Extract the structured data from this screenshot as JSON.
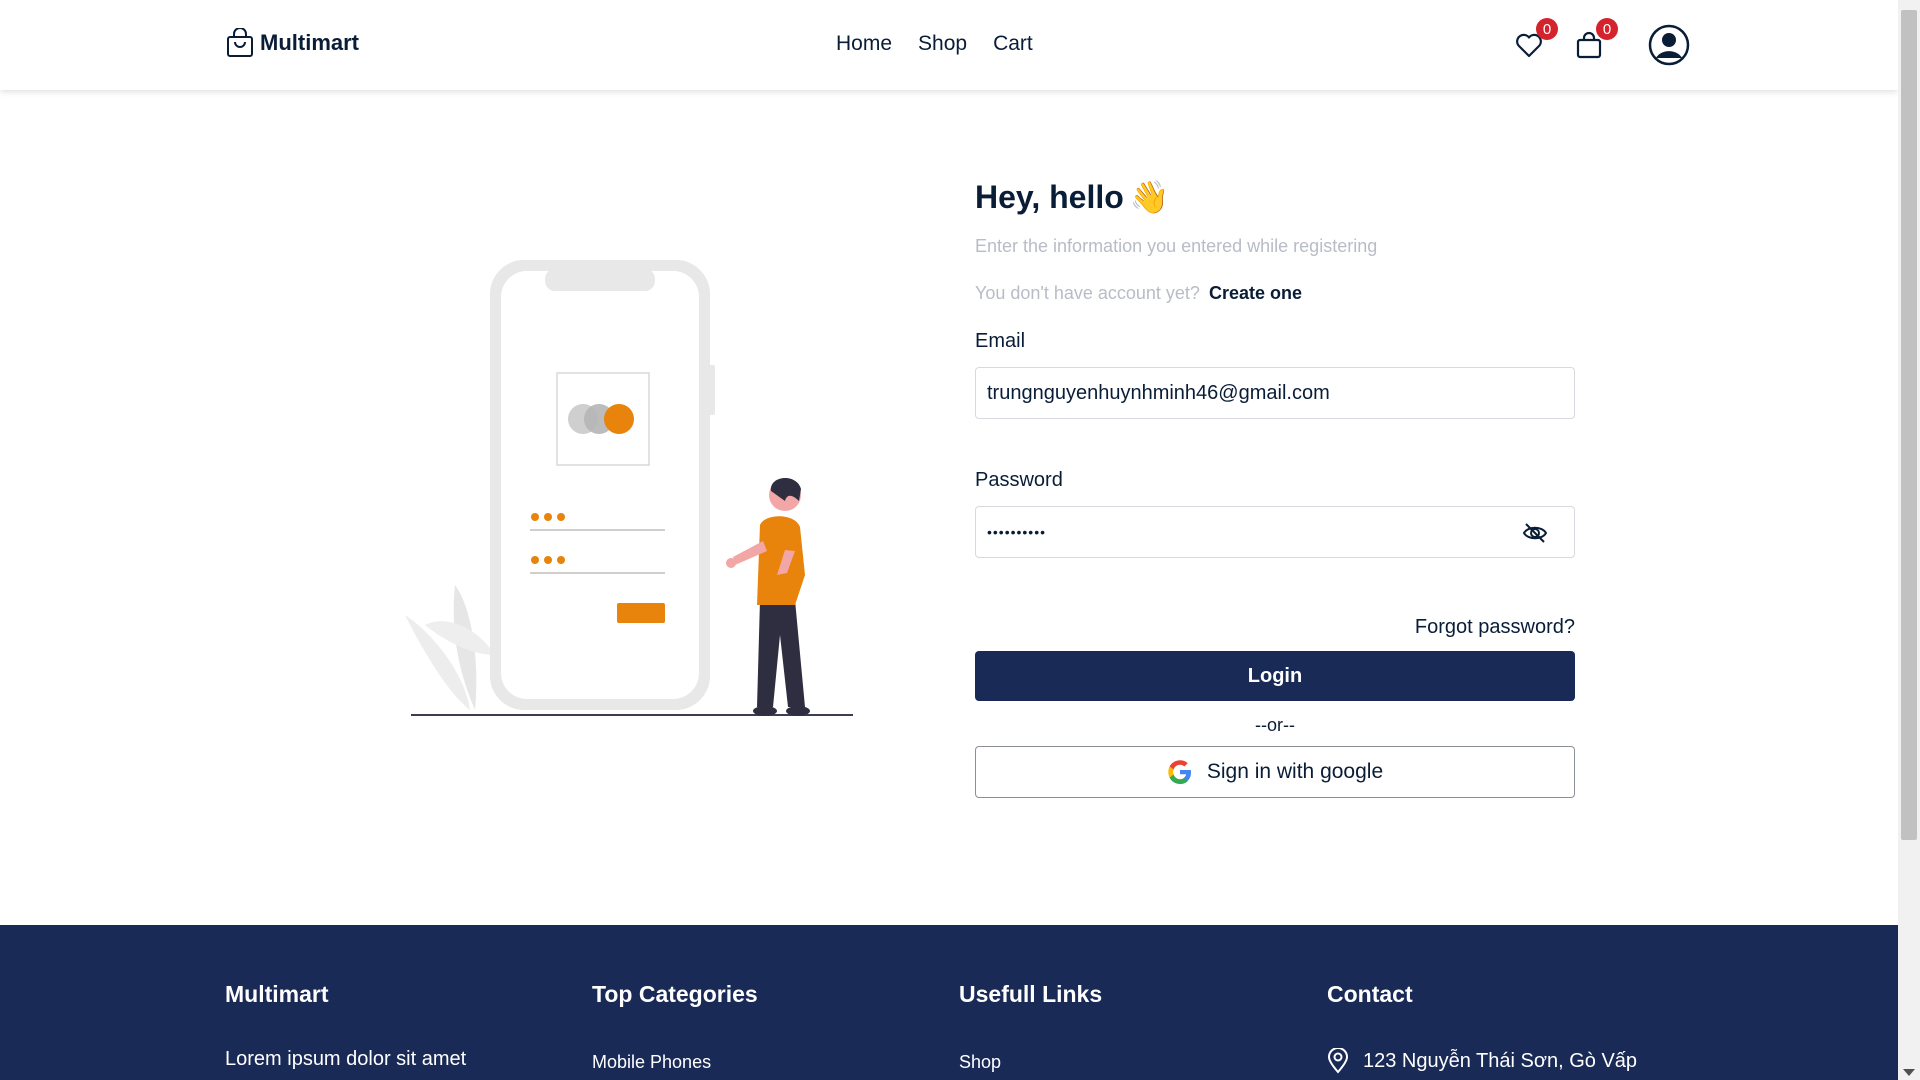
{
  "header": {
    "logo_text": "Multimart",
    "nav": [
      "Home",
      "Shop",
      "Cart"
    ],
    "wishlist_count": "0",
    "cart_count": "0"
  },
  "login": {
    "greeting": "Hey, hello",
    "greeting_emoji": "👋",
    "subtitle": "Enter the information you entered while registering",
    "no_account_text": "You don't have account yet?",
    "create_link": "Create one",
    "email_label": "Email",
    "email_value": "trungnguyenhuynhminh46@gmail.com",
    "password_label": "Password",
    "password_value": "••••••••••",
    "forgot_label": "Forgot password?",
    "login_label": "Login",
    "or_text": "--or--",
    "google_label": "Sign in with google"
  },
  "footer": {
    "col1_title": "Multimart",
    "col1_text": "Lorem ipsum dolor sit amet",
    "col2_title": "Top Categories",
    "col2_item": "Mobile Phones",
    "col3_title": "Usefull Links",
    "col3_item": "Shop",
    "col4_title": "Contact",
    "col4_item": "123 Nguyễn Thái Sơn, Gò Vấp"
  },
  "icons": {
    "logo": "shopping-bag-icon",
    "wishlist": "heart-icon",
    "cart": "shopping-bag-icon",
    "profile": "user-circle-icon",
    "password_toggle": "eye-off-icon",
    "google": "google-g-icon",
    "contact": "map-pin-icon"
  },
  "colors": {
    "primary": "#1a2a56",
    "accent": "#e8830c",
    "badge": "#d4232c",
    "muted_text": "#b7bcc6"
  }
}
